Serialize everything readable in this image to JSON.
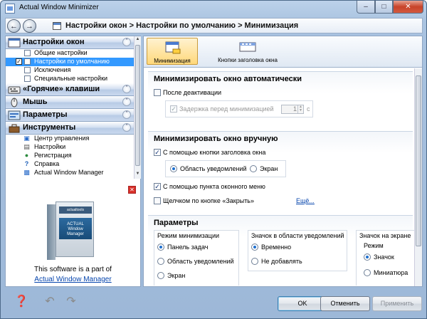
{
  "window": {
    "title": "Actual Window Minimizer"
  },
  "nav": {
    "breadcrumb": "Настройки окон > Настройки по умолчанию > Минимизация"
  },
  "sidebar": {
    "groups": [
      {
        "label": "Настройки окон",
        "items": [
          "Общие настройки",
          "Настройки по умолчанию",
          "Исключения",
          "Специальные настройки"
        ]
      },
      {
        "label": "«Горячие» клавиши"
      },
      {
        "label": "Мышь"
      },
      {
        "label": "Параметры"
      },
      {
        "label": "Инструменты",
        "items": [
          "Центр управления",
          "Настройки",
          "Регистрация",
          "Справка",
          "Actual Window Manager"
        ]
      }
    ]
  },
  "promo": {
    "box_brand": "actualtools",
    "box_product_line1": "ACTUAL",
    "box_product_line2": "Window Manager",
    "text": "This software is a part of",
    "link": "Actual Window Manager"
  },
  "toolstrip": {
    "tabs": [
      "Минимизация",
      "Кнопки заголовка окна"
    ]
  },
  "sections": {
    "auto": {
      "title": "Минимизировать окно автоматически",
      "after_deactivation": "После деактивации",
      "delay_label": "Задержка перед минимизацией",
      "delay_value": "1",
      "delay_unit": "с"
    },
    "manual": {
      "title": "Минимизировать окно вручную",
      "title_button": "С помощью кнопки заголовка окна",
      "radio_tray": "Область уведомлений",
      "radio_screen": "Экран",
      "window_menu": "С помощью пункта оконного меню",
      "close_click": "Щелчком по кнопке «Закрыть»",
      "more_link": "Ещё..."
    },
    "params": {
      "title": "Параметры",
      "mode_title": "Режим минимизации",
      "mode_taskbar": "Панель задач",
      "mode_tray": "Область уведомлений",
      "mode_screen": "Экран",
      "tray_icon_title": "Значок в области уведомлений",
      "tray_temp": "Временно",
      "tray_none": "Не добавлять",
      "screen_icon_title": "Значок на экране",
      "screen_mode_title": "Режим",
      "screen_icon": "Значок",
      "screen_thumb": "Миниатюра"
    }
  },
  "buttons": {
    "ok": "OK",
    "cancel": "Отменить",
    "apply": "Применить"
  },
  "colors": {
    "selected": "#3399ff",
    "link": "#0645ad",
    "close": "#c7432a"
  }
}
